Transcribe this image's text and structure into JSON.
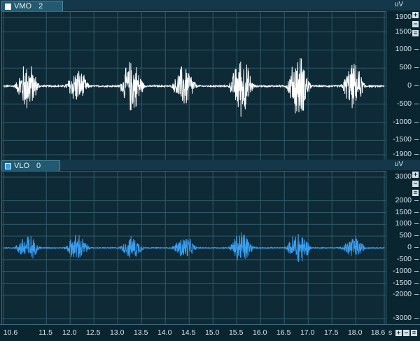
{
  "channels": [
    {
      "name": "VMO",
      "index": "2",
      "unit": "uV",
      "color": "#ffffff",
      "chip_color": "#ffffff",
      "y_ticks": [
        "1900",
        "1500",
        "1000",
        "500",
        "0",
        "-500",
        "-1000",
        "-1500",
        "-1900"
      ],
      "y_range": [
        -1900,
        1900
      ]
    },
    {
      "name": "VLO",
      "index": "0",
      "unit": "uV",
      "color": "#3a9ef0",
      "chip_color": "#3a9ef0",
      "y_ticks": [
        "3000",
        "2000",
        "1500",
        "1000",
        "500",
        "0",
        "-500",
        "-1000",
        "-1500",
        "-2000",
        "-3000"
      ],
      "y_range": [
        -3000,
        3000
      ]
    }
  ],
  "x_axis": {
    "ticks": [
      "10.6",
      "11.5",
      "12.0",
      "12.5",
      "13.0",
      "13.5",
      "14.0",
      "14.5",
      "15.0",
      "15.5",
      "16.0",
      "16.5",
      "17.0",
      "17.5",
      "18.0",
      "18.6"
    ],
    "unit": "s",
    "range": [
      10.6,
      18.6
    ]
  },
  "buttons": {
    "plus": "+",
    "minus": "−",
    "fit": "≡"
  },
  "chart_data": {
    "type": "line",
    "xlabel": "s",
    "xlim": [
      10.6,
      18.6
    ],
    "bursts_center_s": [
      11.1,
      12.15,
      13.3,
      14.4,
      15.6,
      16.8,
      17.95
    ],
    "series": [
      {
        "name": "VMO",
        "unit": "uV",
        "ylim": [
          -1900,
          1900
        ],
        "burst_peak_uV": [
          800,
          550,
          850,
          700,
          950,
          1000,
          700
        ]
      },
      {
        "name": "VLO",
        "unit": "uV",
        "ylim": [
          -3000,
          3000
        ],
        "burst_peak_uV": [
          700,
          700,
          550,
          600,
          850,
          900,
          600
        ]
      }
    ]
  }
}
